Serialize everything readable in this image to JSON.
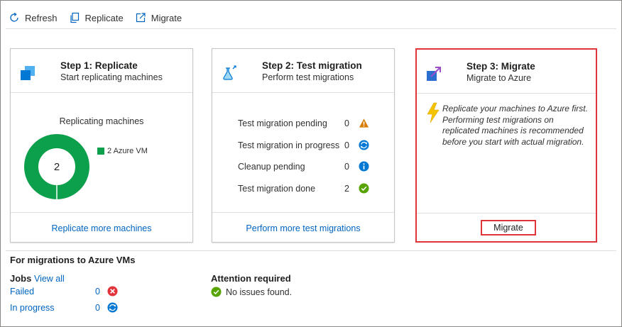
{
  "toolbar": {
    "refresh_label": "Refresh",
    "replicate_label": "Replicate",
    "migrate_label": "Migrate"
  },
  "cards": {
    "replicate": {
      "title": "Step 1: Replicate",
      "subtitle": "Start replicating machines",
      "chart_heading": "Replicating machines",
      "donut_value": "2",
      "legend_label": "2 Azure VM",
      "footer_link": "Replicate more machines"
    },
    "test": {
      "title": "Step 2: Test migration",
      "subtitle": "Perform test migrations",
      "rows": [
        {
          "label": "Test migration pending",
          "count": "0",
          "icon": "warning-icon"
        },
        {
          "label": "Test migration in progress",
          "count": "0",
          "icon": "sync-icon"
        },
        {
          "label": "Cleanup pending",
          "count": "0",
          "icon": "info-icon"
        },
        {
          "label": "Test migration done",
          "count": "2",
          "icon": "check-icon"
        }
      ],
      "footer_link": "Perform more test migrations"
    },
    "migrate": {
      "title": "Step 3: Migrate",
      "subtitle": "Migrate to Azure",
      "message": "Replicate your machines to Azure first. Performing test migrations on replicated machines is recommended before you start with actual migration.",
      "button_label": "Migrate"
    }
  },
  "summary": {
    "section_title": "For migrations to Azure VMs",
    "jobs_label": "Jobs",
    "view_all": "View all",
    "jobs": [
      {
        "label": "Failed",
        "count": "0",
        "icon": "error-icon"
      },
      {
        "label": "In progress",
        "count": "0",
        "icon": "sync-icon"
      }
    ],
    "attention_title": "Attention required",
    "attention_message": "No issues found."
  },
  "colors": {
    "accent_link": "#0064bf",
    "highlight": "#e0343a",
    "success": "#0c9f4c",
    "warning": "#d87b00"
  }
}
